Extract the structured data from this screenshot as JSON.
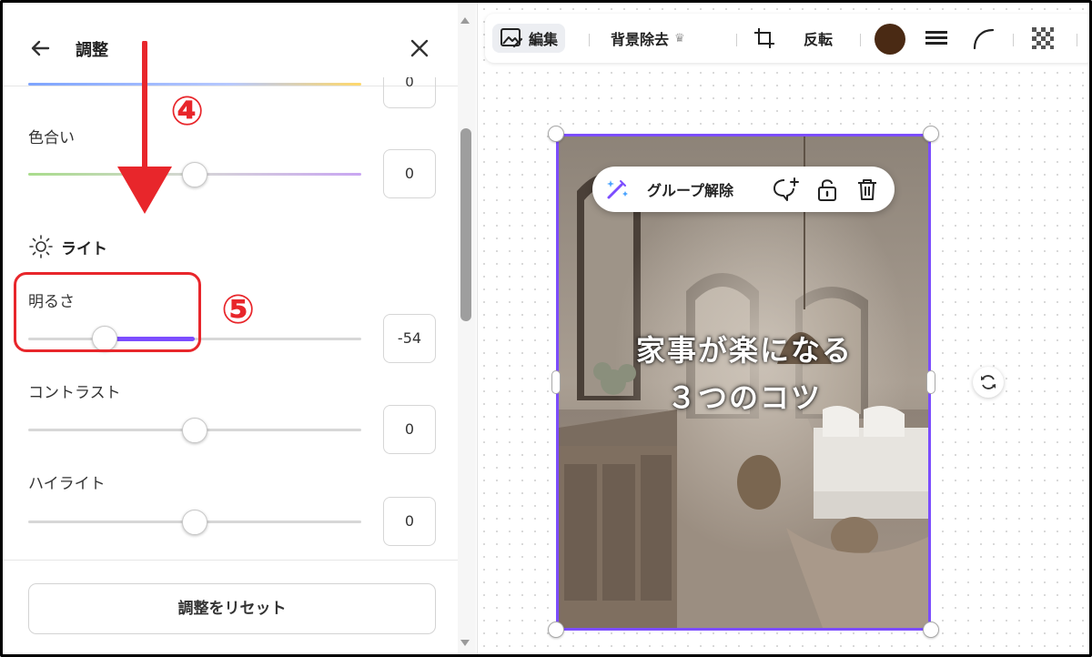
{
  "panel": {
    "title": "調整",
    "partial_top_value": "0",
    "sliders": [
      {
        "label": "色合い",
        "value": "0",
        "fill_fraction": 0.5
      },
      {
        "label": "明るさ",
        "value": "-54",
        "fill_fraction": 0.23
      },
      {
        "label": "コントラスト",
        "value": "0",
        "fill_fraction": 0.5
      },
      {
        "label": "ハイライト",
        "value": "0",
        "fill_fraction": 0.5
      }
    ],
    "light_section": "ライト",
    "reset_label": "調整をリセット"
  },
  "annotations": {
    "step4": "④",
    "step5": "⑤"
  },
  "toolbar": {
    "edit_label": "編集",
    "bg_remove_label": "背景除去",
    "flip_label": "反転",
    "color": "#4a2a14"
  },
  "floating_toolbar": {
    "ungroup_label": "グループ解除"
  },
  "photo": {
    "title_line1": "家事が楽になる",
    "title_line2": "３つのコツ"
  },
  "colors": {
    "accent": "#7c4dff",
    "annotation_red": "#e8262b"
  }
}
